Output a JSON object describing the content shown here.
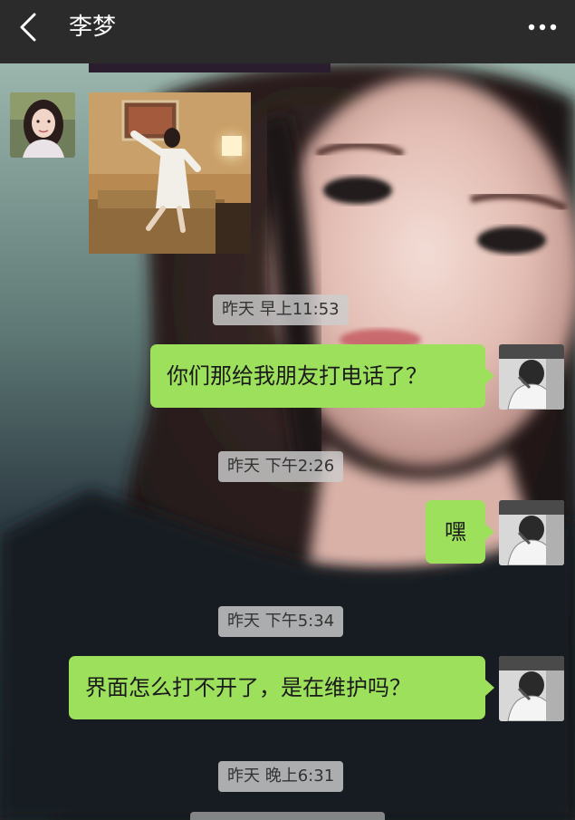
{
  "header": {
    "title": "李梦",
    "back_icon": "chevron-left-icon",
    "more_icon": "more-dots-icon"
  },
  "messages": {
    "ts1": "昨天 早上11:53",
    "msg1": "你们那给我朋友打电话了？",
    "ts2": "昨天 下午2:26",
    "msg2": "嘿",
    "ts3": "昨天 下午5:34",
    "msg3": "界面怎么打不开了，是在维护吗？",
    "ts4": "昨天 晚上6:31"
  },
  "colors": {
    "header_bg": "#2b2b2b",
    "bubble_green": "#9de05c",
    "timestamp_bg": "#cdcdcd"
  }
}
